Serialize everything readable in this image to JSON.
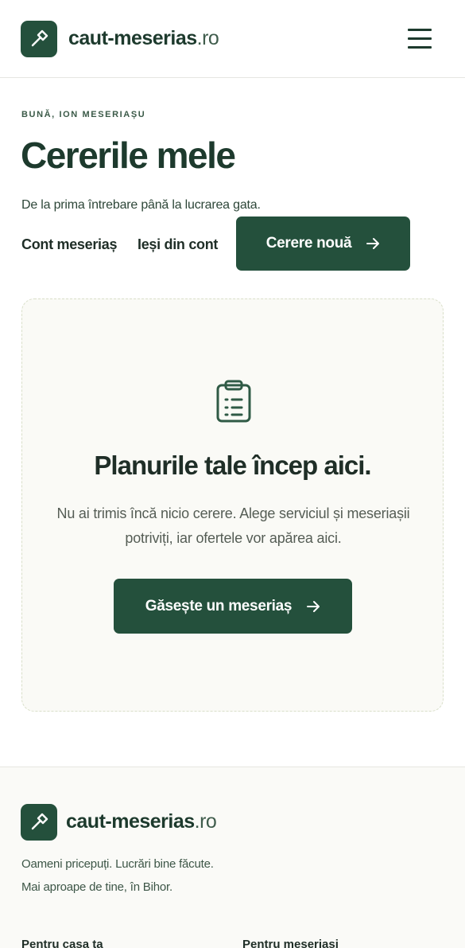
{
  "brand": {
    "name": "caut-meserias",
    "tld": ".ro"
  },
  "colors": {
    "primary": "#24503c",
    "text": "#1d3a2d",
    "card_bg": "#fafaf6",
    "card_border": "#d9dfc9"
  },
  "header": {
    "menu_icon": "hamburger-menu-icon"
  },
  "greeting": "BUNĂ, ION MESERIAȘU",
  "title": "Cererile mele",
  "subtitle": "De la prima întrebare până la lucrarea gata.",
  "nav": {
    "account": "Cont meseriaș",
    "logout": "Ieși din cont"
  },
  "new_request": {
    "label": "Cerere nouă",
    "icon": "arrow-right-icon"
  },
  "empty_state": {
    "icon": "clipboard-list-icon",
    "title": "Planurile tale încep aici.",
    "description": "Nu ai trimis încă nicio cerere. Alege serviciul și meseriașii potriviți, iar ofertele vor apărea aici.",
    "cta": "Găsește un meseriaș"
  },
  "footer": {
    "tagline_1": "Oameni pricepuți. Lucrări bine făcute.",
    "tagline_2": "Mai aproape de tine, în Bihor.",
    "col_1": "Pentru casa ta",
    "col_2": "Pentru meseriași"
  }
}
